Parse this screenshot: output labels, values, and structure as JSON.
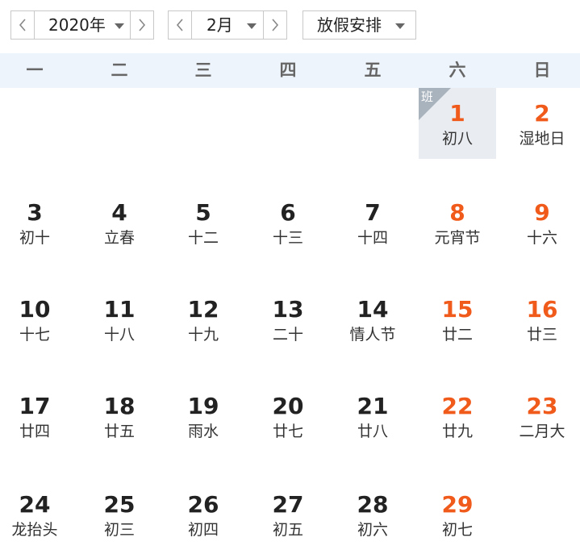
{
  "toolbar": {
    "year": "2020年",
    "month": "2月",
    "holiday": "放假安排"
  },
  "weekdays": [
    "一",
    "二",
    "三",
    "四",
    "五",
    "六",
    "日"
  ],
  "days": [
    {
      "num": "1",
      "sub": "初八",
      "weekend": true,
      "badge": "班",
      "highlight": true
    },
    {
      "num": "2",
      "sub": "湿地日",
      "weekend": true
    },
    {
      "num": "3",
      "sub": "初十"
    },
    {
      "num": "4",
      "sub": "立春"
    },
    {
      "num": "5",
      "sub": "十二"
    },
    {
      "num": "6",
      "sub": "十三"
    },
    {
      "num": "7",
      "sub": "十四"
    },
    {
      "num": "8",
      "sub": "元宵节",
      "weekend": true
    },
    {
      "num": "9",
      "sub": "十六",
      "weekend": true
    },
    {
      "num": "10",
      "sub": "十七"
    },
    {
      "num": "11",
      "sub": "十八"
    },
    {
      "num": "12",
      "sub": "十九"
    },
    {
      "num": "13",
      "sub": "二十"
    },
    {
      "num": "14",
      "sub": "情人节"
    },
    {
      "num": "15",
      "sub": "廿二",
      "weekend": true
    },
    {
      "num": "16",
      "sub": "廿三",
      "weekend": true
    },
    {
      "num": "17",
      "sub": "廿四"
    },
    {
      "num": "18",
      "sub": "廿五"
    },
    {
      "num": "19",
      "sub": "雨水"
    },
    {
      "num": "20",
      "sub": "廿七"
    },
    {
      "num": "21",
      "sub": "廿八"
    },
    {
      "num": "22",
      "sub": "廿九",
      "weekend": true
    },
    {
      "num": "23",
      "sub": "二月大",
      "weekend": true
    },
    {
      "num": "24",
      "sub": "龙抬头"
    },
    {
      "num": "25",
      "sub": "初三"
    },
    {
      "num": "26",
      "sub": "初四"
    },
    {
      "num": "27",
      "sub": "初五"
    },
    {
      "num": "28",
      "sub": "初六"
    },
    {
      "num": "29",
      "sub": "初七",
      "weekend": true
    }
  ],
  "colors": {
    "weekend": "#f05a1a",
    "header_bg": "#eef4fb",
    "highlight_bg": "#e9ecf1",
    "badge": "#a9b3be"
  },
  "icons": {
    "prev": "chevron-left-icon",
    "next": "chevron-right-icon",
    "dropdown": "caret-down-icon"
  }
}
